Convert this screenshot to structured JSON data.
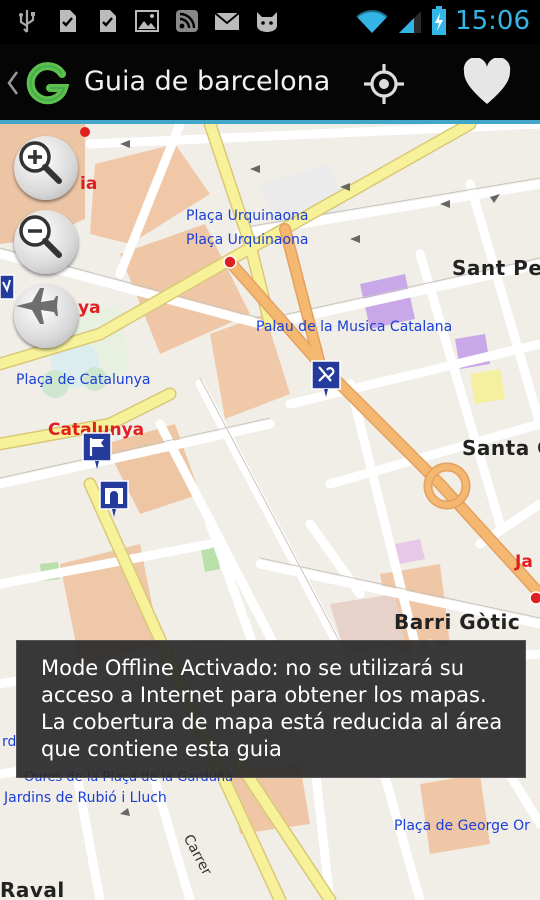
{
  "status_bar": {
    "time": "15:06",
    "icons": [
      "usb-icon",
      "sd-card-icon",
      "sd-card-icon",
      "image-icon",
      "rss-icon",
      "mail-icon",
      "cat-icon",
      "wifi-icon",
      "signal-icon",
      "battery-charging-icon"
    ]
  },
  "action_bar": {
    "title": "Guia de barcelona",
    "icons": [
      "back-chevron-icon",
      "app-logo-icon",
      "locate-icon",
      "heart-icon"
    ]
  },
  "map": {
    "labels": {
      "placa_urquinaona_1": "Plaça Urquinaona",
      "placa_urquinaona_2": "Plaça Urquinaona",
      "sant_pere": "Sant Pe",
      "palau_musica": "Palau de la Musica Catalana",
      "placa_catalunya": "Plaça de Catalunya",
      "catalunya": "Catalunya",
      "santa_c": "Santa C",
      "barri_gotic": "Barri Gòtic",
      "placa_george_orwell": "Plaça de George Or",
      "jardins": "Jardins de Rubió i Lluch",
      "hores": "Oures de la Plaça de la Garduña",
      "carrer": "Carrer",
      "raval": "Raval",
      "ja": "Ja",
      "ya": "ya",
      "ia": "ia",
      "rd": "rd"
    },
    "controls": [
      "zoom-in",
      "zoom-out",
      "airplane-mode"
    ]
  },
  "toast": {
    "message": "Mode Offline Activado: no se utilizará su acceso a Internet para obtener los mapas. La cobertura de mapa está reducida al área que contiene esta guia"
  },
  "colors": {
    "accent": "#41a6c8",
    "status_blue": "#33b5e5",
    "road_orange": "#f4b870",
    "road_yellow": "#f7f29a",
    "poi_blue": "#243b9c"
  }
}
